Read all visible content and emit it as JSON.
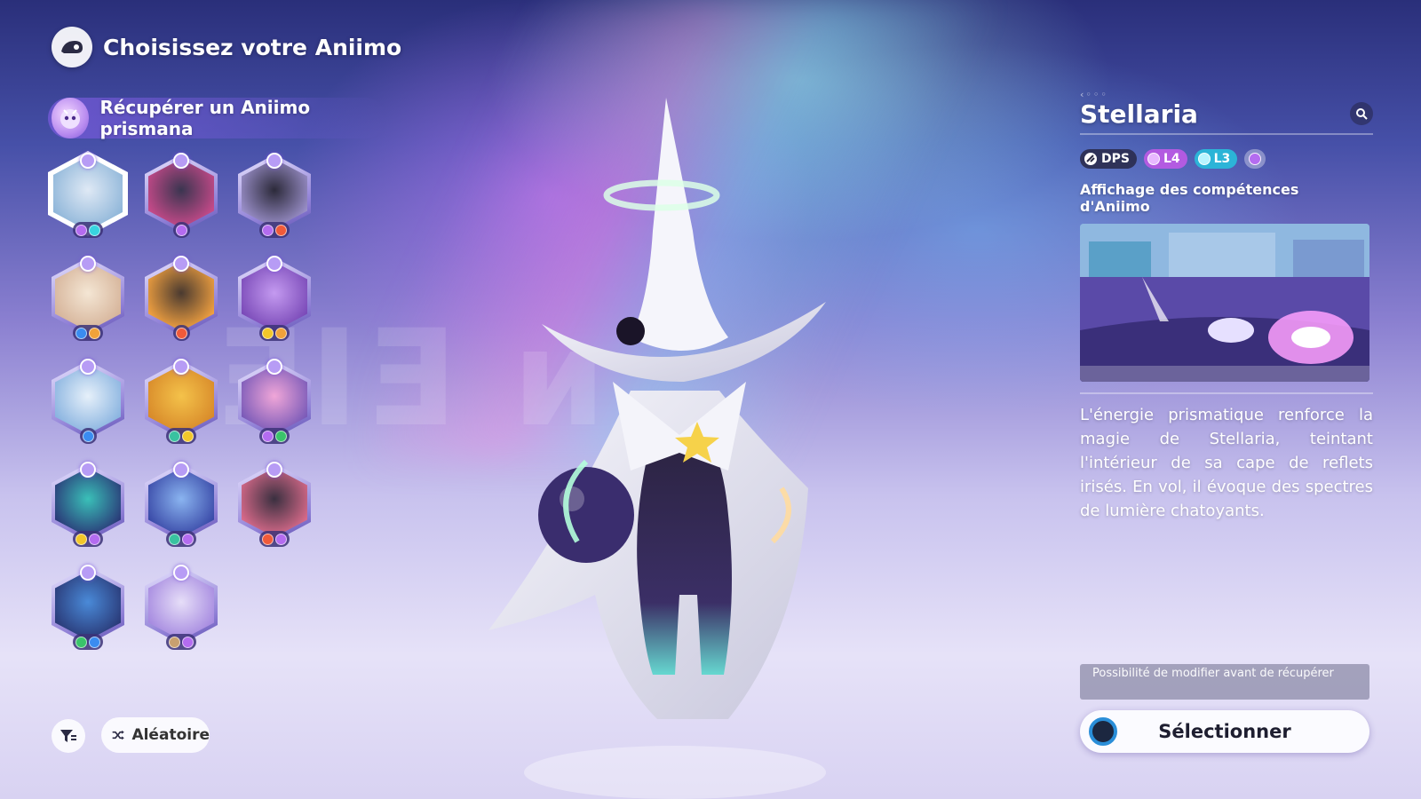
{
  "header": {
    "title": "Choisissez votre Aniimo"
  },
  "mode": {
    "label": "Récupérer un Aniimo prismana"
  },
  "roster": [
    {
      "name": "aniimo-1",
      "selected": true,
      "elements": [
        "prism",
        "ice"
      ],
      "color_a": "#dfe9f5",
      "color_b": "#8fb6d9"
    },
    {
      "name": "aniimo-2",
      "selected": false,
      "elements": [
        "prism"
      ],
      "color_a": "#3a3550",
      "color_b": "#c74a8a"
    },
    {
      "name": "aniimo-3",
      "selected": false,
      "elements": [
        "prism",
        "fire"
      ],
      "color_a": "#2c2a3a",
      "color_b": "#9a8fc9"
    },
    {
      "name": "aniimo-4",
      "selected": false,
      "elements": [
        "water",
        "gear"
      ],
      "color_a": "#f4e6d4",
      "color_b": "#d6b49a"
    },
    {
      "name": "aniimo-5",
      "selected": false,
      "elements": [
        "fire"
      ],
      "color_a": "#4a3a30",
      "color_b": "#f0a040"
    },
    {
      "name": "aniimo-6",
      "selected": false,
      "elements": [
        "electric",
        "gear"
      ],
      "color_a": "#c49af0",
      "color_b": "#7a4ab8"
    },
    {
      "name": "aniimo-7",
      "selected": false,
      "elements": [
        "water"
      ],
      "color_a": "#e6f0fa",
      "color_b": "#8ab4e0"
    },
    {
      "name": "aniimo-8",
      "selected": false,
      "elements": [
        "wind",
        "electric"
      ],
      "color_a": "#f4c24a",
      "color_b": "#d88a2a"
    },
    {
      "name": "aniimo-9",
      "selected": false,
      "elements": [
        "prism",
        "leaf"
      ],
      "color_a": "#f0a6d8",
      "color_b": "#7a5ab8"
    },
    {
      "name": "aniimo-10",
      "selected": false,
      "elements": [
        "electric",
        "prism"
      ],
      "color_a": "#3ac0b8",
      "color_b": "#2a3a78"
    },
    {
      "name": "aniimo-11",
      "selected": false,
      "elements": [
        "wind",
        "prism"
      ],
      "color_a": "#8ab4f0",
      "color_b": "#3a4aa8"
    },
    {
      "name": "aniimo-12",
      "selected": false,
      "elements": [
        "fire",
        "prism"
      ],
      "color_a": "#3a3040",
      "color_b": "#d86a8a"
    },
    {
      "name": "aniimo-13",
      "selected": false,
      "elements": [
        "leaf",
        "water"
      ],
      "color_a": "#4a8ad8",
      "color_b": "#2a3a78"
    },
    {
      "name": "aniimo-14",
      "selected": false,
      "elements": [
        "earth",
        "prism"
      ],
      "color_a": "#e6def8",
      "color_b": "#a68ae0"
    }
  ],
  "footer_left": {
    "random_label": "Aléatoire"
  },
  "details": {
    "name": "Stellaria",
    "tags": {
      "role": "DPS",
      "prism_level": "L4",
      "ice_level": "L3"
    },
    "skills_title": "Affichage des compétences d'Aniimo",
    "description": "L'énergie prismatique renforce la magie de Stellaria, teintant l'intérieur de sa cape de reflets irisés. En vol, il évoque des spectres de lumière chatoyants.",
    "note": "Possibilité de modifier avant de récupérer",
    "select_label": "Sélectionner"
  },
  "colors": {
    "accent_prism": "#b46cf0",
    "accent_ice": "#38d4e0",
    "button_ring": "#2a8ed8"
  },
  "icons": [
    "back-icon",
    "prism-gem-icon",
    "filter-icon",
    "shuffle-icon",
    "search-icon",
    "dps-icon",
    "ps-circle-icon"
  ]
}
